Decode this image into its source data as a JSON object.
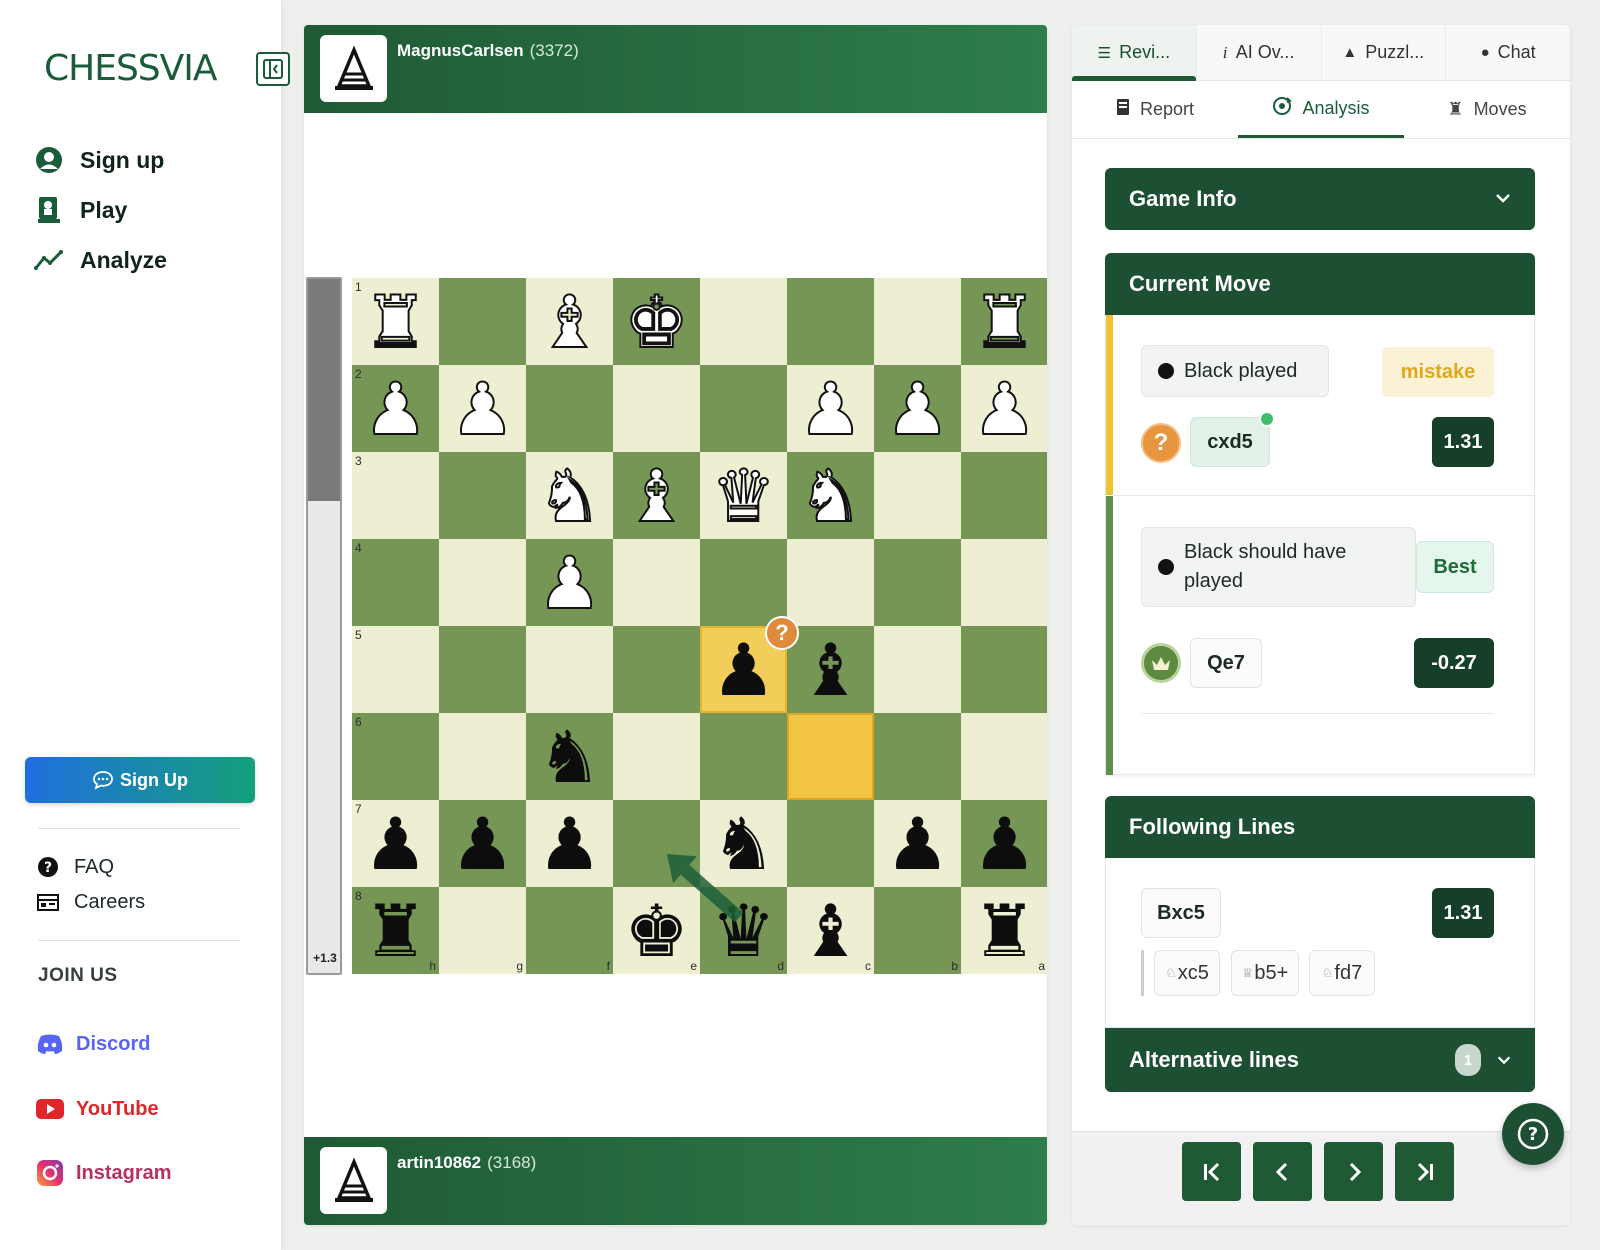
{
  "sidebar": {
    "logo": "CHESSVIA",
    "nav": [
      {
        "label": "Sign up",
        "icon": "user-circle-icon"
      },
      {
        "label": "Play",
        "icon": "chess-pawn-icon"
      },
      {
        "label": "Analyze",
        "icon": "trend-line-icon"
      }
    ],
    "cta_label": "Sign Up",
    "links": [
      {
        "label": "FAQ",
        "icon": "question-circle-icon"
      },
      {
        "label": "Careers",
        "icon": "briefcase-icon"
      }
    ],
    "join_us": "JOIN US",
    "socials": [
      {
        "label": "Discord",
        "icon": "discord-icon",
        "color": "#5865f2"
      },
      {
        "label": "YouTube",
        "icon": "youtube-icon",
        "color": "#e0262a"
      },
      {
        "label": "Instagram",
        "icon": "instagram-icon",
        "color": "#b6325e"
      }
    ]
  },
  "players": {
    "top": {
      "name": "MagnusCarlsen",
      "rating": "(3372)"
    },
    "bottom": {
      "name": "artin10862",
      "rating": "(3168)"
    }
  },
  "eval": {
    "label": "+1.3",
    "black_share": 0.32
  },
  "board": {
    "ranks_label": [
      "1",
      "2",
      "3",
      "4",
      "5",
      "6",
      "7",
      "8"
    ],
    "files_label": [
      "h",
      "g",
      "f",
      "e",
      "d",
      "c",
      "b",
      "a"
    ],
    "rows": [
      [
        "wR",
        "",
        "wB",
        "wK",
        "",
        "",
        "",
        "wR"
      ],
      [
        "wP",
        "wP",
        "",
        "",
        "",
        "wP",
        "wP",
        "wP"
      ],
      [
        "",
        "",
        "wN",
        "wB",
        "wQ",
        "wN",
        "",
        ""
      ],
      [
        "",
        "",
        "wP",
        "",
        "",
        "",
        "",
        ""
      ],
      [
        "",
        "",
        "",
        "",
        "bP",
        "bB",
        "",
        ""
      ],
      [
        "",
        "",
        "bN",
        "",
        "",
        "",
        "",
        ""
      ],
      [
        "bP",
        "bP",
        "bP",
        "",
        "bN",
        "",
        "bP",
        "bP"
      ],
      [
        "bR",
        "",
        "",
        "bK",
        "bQ",
        "bB",
        "",
        "bR"
      ]
    ],
    "highlight_from": [
      4,
      4
    ],
    "highlight_to": [
      5,
      5
    ],
    "mistake_square": [
      4,
      4
    ],
    "arrow": {
      "from": [
        7,
        4
      ],
      "to": [
        6,
        3
      ]
    },
    "colors": {
      "light": "#eeeed2",
      "dark": "#769656"
    }
  },
  "tabs_top": [
    {
      "label": "Revi...",
      "icon": "list-icon",
      "active": true
    },
    {
      "label": "AI Ov...",
      "icon": "info-icon",
      "active": false
    },
    {
      "label": "Puzzl...",
      "icon": "warning-icon",
      "active": false
    },
    {
      "label": "Chat",
      "icon": "chat-icon",
      "active": false
    }
  ],
  "tabs_sub": [
    {
      "label": "Report",
      "icon": "report-icon",
      "active": false
    },
    {
      "label": "Analysis",
      "icon": "analysis-icon",
      "active": true
    },
    {
      "label": "Moves",
      "icon": "rook-icon",
      "active": false
    }
  ],
  "game_info": {
    "title": "Game Info"
  },
  "current_move": {
    "title": "Current Move",
    "played_label": "Black played",
    "classification": "mistake",
    "move": "cxd5",
    "score": "1.31",
    "should_label": "Black should have played",
    "best_tag": "Best",
    "best_move": "Qe7",
    "best_score": "-0.27"
  },
  "following_lines": {
    "title": "Following Lines",
    "move": "Bxc5",
    "score": "1.31",
    "continuation": [
      {
        "piece": "♘",
        "san": "xc5"
      },
      {
        "piece": "♕",
        "san": "b5+"
      },
      {
        "piece": "♘",
        "san": "fd7"
      }
    ]
  },
  "alternative_lines": {
    "title": "Alternative lines",
    "count": "1"
  },
  "accent": "#1d4f32"
}
